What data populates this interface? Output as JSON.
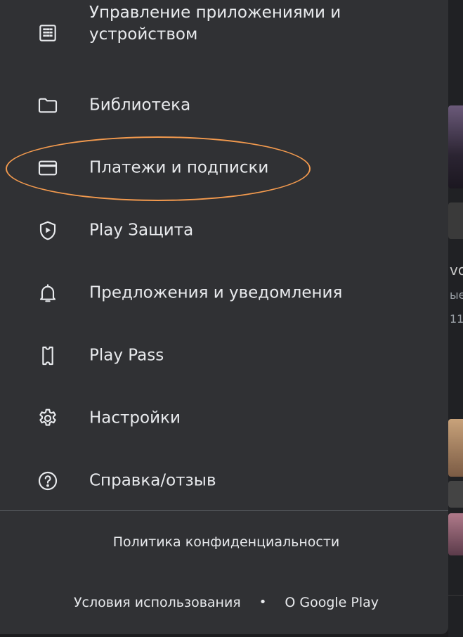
{
  "colors": {
    "drawer_background": "#303134",
    "text": "#e8eaed",
    "icon": "#e8eaed",
    "divider": "#5f6368",
    "highlight_oval": "#f39a4e"
  },
  "menu": {
    "items": [
      {
        "label": "Управление приложениями и устройством",
        "icon": "apps-grid-icon"
      },
      {
        "label": "Библиотека",
        "icon": "folder-icon"
      },
      {
        "label": "Платежи и подписки",
        "icon": "credit-card-icon"
      },
      {
        "label": "Play Защита",
        "icon": "shield-play-icon"
      },
      {
        "label": "Предложения и уведомления",
        "icon": "bell-icon"
      },
      {
        "label": "Play Pass",
        "icon": "ticket-icon"
      },
      {
        "label": "Настройки",
        "icon": "gear-icon"
      },
      {
        "label": "Справка/отзыв",
        "icon": "help-circle-icon"
      }
    ]
  },
  "footer": {
    "privacy": "Политика конфиденциальности",
    "terms": "Условия использования",
    "separator": "•",
    "about": "О Google Play"
  },
  "background": {
    "text_a": "vo",
    "text_b": "ые",
    "text_c": "11"
  }
}
